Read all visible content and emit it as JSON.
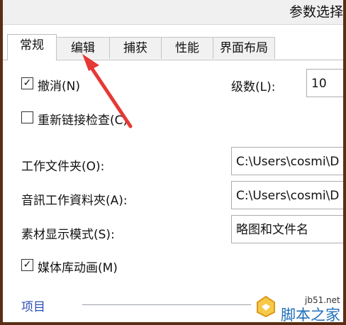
{
  "window": {
    "title": "参数选择"
  },
  "tabs": [
    {
      "label": "常规"
    },
    {
      "label": "编辑"
    },
    {
      "label": "捕获"
    },
    {
      "label": "性能"
    },
    {
      "label": "界面布局"
    }
  ],
  "general": {
    "undo": {
      "label": "撤消(N)",
      "checked": true
    },
    "levels": {
      "label": "级数(L):",
      "value": "10"
    },
    "relink": {
      "label": "重新链接检查(C)",
      "checked": false
    },
    "work_folder": {
      "label": "工作文件夹(O):",
      "value": "C:\\Users\\cosmi\\D"
    },
    "audio_folder": {
      "label": "音訊工作資料夾(A):",
      "value": "C:\\Users\\cosmi\\D"
    },
    "display_mode": {
      "label": "素材显示模式(S):",
      "value": "略图和文件名"
    },
    "media_anim": {
      "label": "媒体库动画(M)",
      "checked": true
    },
    "section": "项目"
  },
  "watermark": {
    "site": "jb51.net",
    "name": "脚本之家"
  },
  "annotation": {
    "color": "#e53935"
  }
}
